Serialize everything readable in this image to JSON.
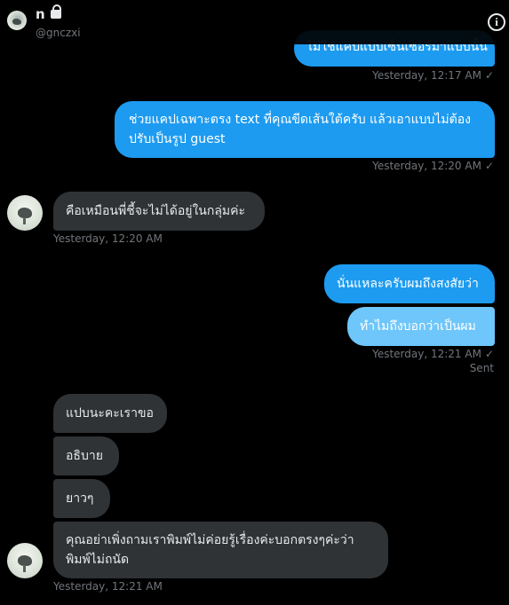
{
  "header": {
    "name": "n",
    "handle": "@gnczxi"
  },
  "messages": {
    "m0": "ไม่ใช่แคปแบบเซ็นเซอร์มาแบบนั้น",
    "m0_time": "Yesterday, 12:17 AM",
    "m1_line1": "ช่วยแคปเฉพาะตรง text ที่คุณขีดเส้นใต้ครับ แล้วเอาแบบไม่ต้อง",
    "m1_line2": "ปรับเป็นรูป guest",
    "m1_time": "Yesterday, 12:20 AM",
    "m2": "คือเหมือนพี่ชี้จะไม่ได้อยู่ในกลุ่มค่ะ",
    "m2_time": "Yesterday, 12:20 AM",
    "m3": "นั่นแหละครับผมถึงสงสัยว่า",
    "m4": "ทำไมถึงบอกว่าเป็นผม",
    "m4_time": "Yesterday, 12:21 AM",
    "m4_status": "Sent",
    "m5": "แปบนะคะเราขอ",
    "m6": "อธิบาย",
    "m7": "ยาวๆ",
    "m8_line1": "คุณอย่าเพิ่งถามเราพิมพ์ไม่ค่อยรู้เรื่องค่ะบอกตรงๆค่ะว่า",
    "m8_line2": "พิมพ์ไม่ถนัด",
    "m8_time": "Yesterday, 12:21 AM",
    "check_glyph": "✓"
  },
  "colors": {
    "outgoing": "#1d9bf0",
    "outgoing_pending": "#6ec6fa",
    "incoming": "#2f3336",
    "background": "#000000"
  },
  "icons": [
    "lock-icon",
    "info-icon",
    "check-icon"
  ]
}
